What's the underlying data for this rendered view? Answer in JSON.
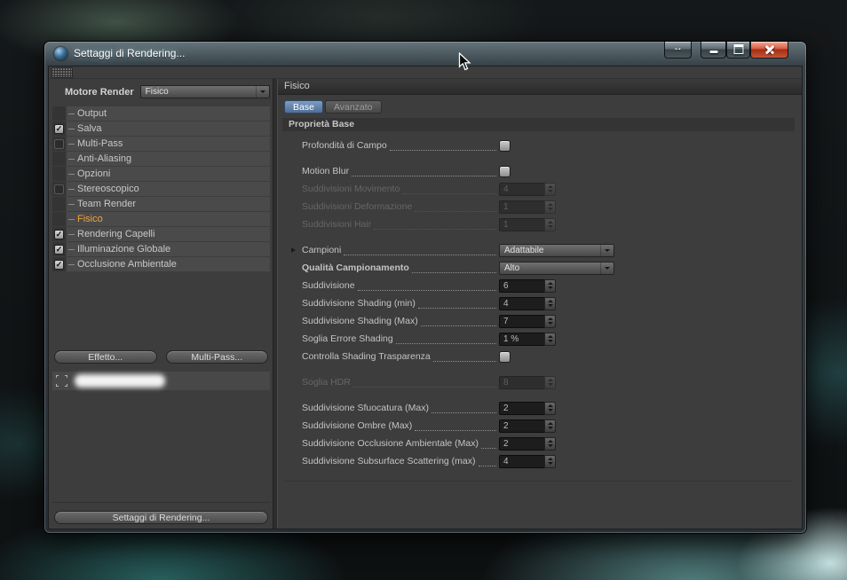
{
  "window": {
    "title": "Settaggi di Rendering...",
    "controls": {
      "expand_icon": "double-arrow-icon",
      "minimize_icon": "minimize-icon",
      "maximize_icon": "maximize-icon",
      "close_icon": "close-icon"
    }
  },
  "left": {
    "engine_label": "Motore Render",
    "engine_value": "Fisico",
    "tree": [
      {
        "label": "Output",
        "checkbox": "none"
      },
      {
        "label": "Salva",
        "checkbox": "checked"
      },
      {
        "label": "Multi-Pass",
        "checkbox": "unchecked"
      },
      {
        "label": "Anti-Aliasing",
        "checkbox": "none"
      },
      {
        "label": "Opzioni",
        "checkbox": "none"
      },
      {
        "label": "Stereoscopico",
        "checkbox": "unchecked"
      },
      {
        "label": "Team Render",
        "checkbox": "none"
      },
      {
        "label": "Fisico",
        "checkbox": "none",
        "selected": true
      },
      {
        "label": "Rendering Capelli",
        "checkbox": "checked"
      },
      {
        "label": "Illuminazione Globale",
        "checkbox": "checked"
      },
      {
        "label": "Occlusione Ambientale",
        "checkbox": "checked"
      }
    ],
    "effect_button": "Effetto...",
    "multipass_button": "Multi-Pass...",
    "settings_button": "Settaggi di Rendering..."
  },
  "right": {
    "header": "Fisico",
    "tabs": [
      {
        "label": "Base",
        "active": true
      },
      {
        "label": "Avanzato",
        "active": false
      }
    ],
    "section": "Proprietà Base",
    "params": [
      {
        "name": "profondita-di-campo",
        "label": "Profondità di Campo",
        "type": "checkbox",
        "checked": false,
        "enabled": true
      },
      {
        "type": "spacer"
      },
      {
        "name": "motion-blur",
        "label": "Motion Blur",
        "type": "checkbox",
        "checked": false,
        "enabled": true
      },
      {
        "name": "suddivisioni-movimento",
        "label": "Suddivisioni Movimento",
        "type": "spinner",
        "value": "4",
        "enabled": false
      },
      {
        "name": "suddivisioni-deformazione",
        "label": "Suddivisioni Deformazione",
        "type": "spinner",
        "value": "1",
        "enabled": false
      },
      {
        "name": "suddivisioni-hair",
        "label": "Suddivisioni Hair",
        "type": "spinner",
        "value": "1",
        "enabled": false
      },
      {
        "type": "spacer"
      },
      {
        "name": "campioni",
        "label": "Campioni",
        "type": "dropdown",
        "value": "Adattabile",
        "enabled": true,
        "expander": true
      },
      {
        "name": "qualita-campionamento",
        "label": "Qualità Campionamento",
        "type": "dropdown",
        "value": "Alto",
        "enabled": true,
        "bold": true
      },
      {
        "name": "suddivisione",
        "label": "Suddivisione",
        "type": "spinner",
        "value": "6",
        "enabled": true
      },
      {
        "name": "suddivisione-shading-min",
        "label": "Suddivisione Shading (min)",
        "type": "spinner",
        "value": "4",
        "enabled": true
      },
      {
        "name": "suddivisione-shading-max",
        "label": "Suddivisione Shading (Max)",
        "type": "spinner",
        "value": "7",
        "enabled": true
      },
      {
        "name": "soglia-errore-shading",
        "label": "Soglia Errore Shading",
        "type": "spinner",
        "value": "1 %",
        "enabled": true
      },
      {
        "name": "controlla-shading-trasparenza",
        "label": "Controlla Shading Trasparenza",
        "type": "checkbox",
        "checked": false,
        "enabled": true
      },
      {
        "type": "spacer"
      },
      {
        "name": "soglia-hdr",
        "label": "Soglia HDR",
        "type": "spinner",
        "value": "8",
        "enabled": false
      },
      {
        "type": "spacer"
      },
      {
        "name": "suddivisione-sfuocatura-max",
        "label": "Suddivisione Sfuocatura (Max)",
        "type": "spinner",
        "value": "2",
        "enabled": true
      },
      {
        "name": "suddivisione-ombre-max",
        "label": "Suddivisione Ombre (Max)",
        "type": "spinner",
        "value": "2",
        "enabled": true
      },
      {
        "name": "suddivisione-occlusione-ambientale-max",
        "label": "Suddivisione Occlusione Ambientale (Max)",
        "type": "spinner",
        "value": "2",
        "enabled": true
      },
      {
        "name": "suddivisione-subsurface-scattering-max",
        "label": "Suddivisione Subsurface Scattering (max)",
        "type": "spinner",
        "value": "4",
        "enabled": true
      }
    ]
  },
  "colors": {
    "selected_item": "#f0a43c",
    "tab_active": "#5f7fa8",
    "close_button": "#c0392b",
    "panel_bg": "#3d3d3d"
  }
}
